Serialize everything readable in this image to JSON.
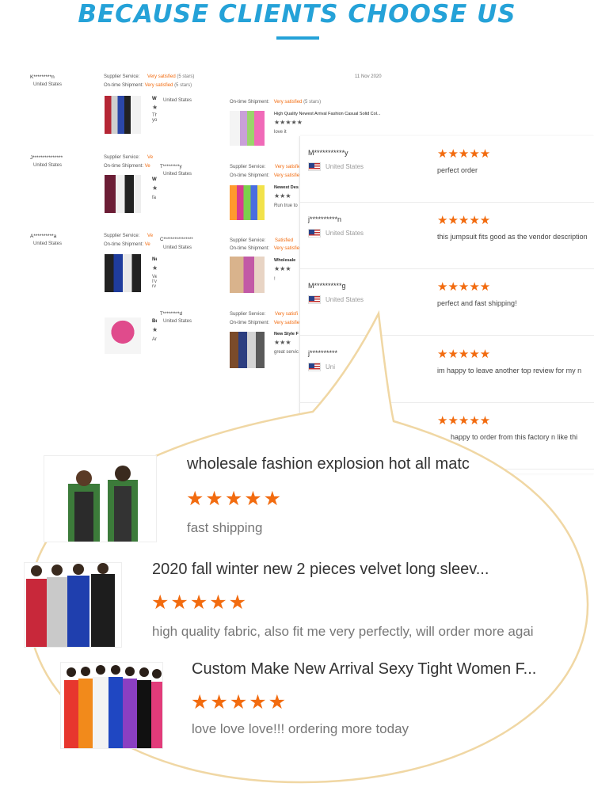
{
  "heading": "BECAUSE CLIENTS CHOOSE US",
  "panel_a": [
    {
      "name": "K*********n",
      "country": "United States",
      "service_label": "Supplier Service:",
      "service": "Very satisfied",
      "service_note": "(5 stars)",
      "shipment_label": "On-time Shipment:",
      "shipment": "Very satisfied",
      "shipment_note": "(5 stars)",
      "title": "W",
      "text": "Th yo"
    },
    {
      "name": "J***************",
      "country": "United States",
      "service_label": "Supplier Service:",
      "service": "Ve",
      "shipment_label": "On-time Shipment:",
      "shipment": "Ve",
      "title": "W",
      "text": "fa"
    },
    {
      "name": "A**********a",
      "country": "United States",
      "service_label": "Supplier Service:",
      "service": "Ve",
      "shipment_label": "On-time Shipment:",
      "shipment": "Ve",
      "title": "Ne",
      "text": "Ve I'v rv"
    },
    {
      "title": "Be",
      "text": "Ar"
    }
  ],
  "date": "11 Nov 2020",
  "panel_b": [
    {
      "country": "United States",
      "shipment_label": "On-time Shipment:",
      "shipment": "Very satisfied",
      "shipment_note": "(5 stars)",
      "title": "High Quality Newest Arrival Fashion Casual Solid Col...",
      "text": "love it"
    },
    {
      "name": "T*********y",
      "country": "United States",
      "service_label": "Supplier Service:",
      "service": "Very satisfied",
      "shipment_label": "On-time Shipment:",
      "shipment": "Very satisfied",
      "title": "Newest Des",
      "text": "Run true to"
    },
    {
      "name": "C****************",
      "country": "United States",
      "service_label": "Supplier Service:",
      "service": "Satisfied",
      "shipment_label": "On-time Shipment:",
      "shipment": "Very satisfie",
      "title": "Wholesale",
      "text": "!"
    },
    {
      "name": "T*********d",
      "country": "United States",
      "service_label": "Supplier Service:",
      "service": "Very satisfi",
      "shipment_label": "On-time Shipment:",
      "shipment": "Very satisfie",
      "title": "New Style F",
      "text": "great servic"
    }
  ],
  "stars_full": "★★★★★",
  "stars_partial": "★★★",
  "panel_c": [
    {
      "name": "M***********y",
      "country": "United States",
      "text": "perfect order"
    },
    {
      "name": "j**********n",
      "country": "United States",
      "text": "this jumpsuit fits good as the vendor description"
    },
    {
      "name": "M**********g",
      "country": "United States",
      "text": "perfect and fast shipping!"
    },
    {
      "name": "j**********",
      "country": "Uni",
      "text": "im happy to leave another top review for my n"
    },
    {
      "name": "",
      "country": "",
      "text": "happy to order from this factory n like thi"
    }
  ],
  "bubble": [
    {
      "title": "wholesale fashion explosion hot all matc",
      "stars": "★★★★★",
      "text": "fast shipping"
    },
    {
      "title": "2020 fall winter new 2 pieces velvet long sleev...",
      "stars": "★★★★★",
      "text": "high quality fabric, also fit me very perfectly, will order more agai"
    },
    {
      "title": "Custom Make New Arrival Sexy Tight Women F...",
      "stars": "★★★★★",
      "text": "love love love!!! ordering more today"
    }
  ]
}
